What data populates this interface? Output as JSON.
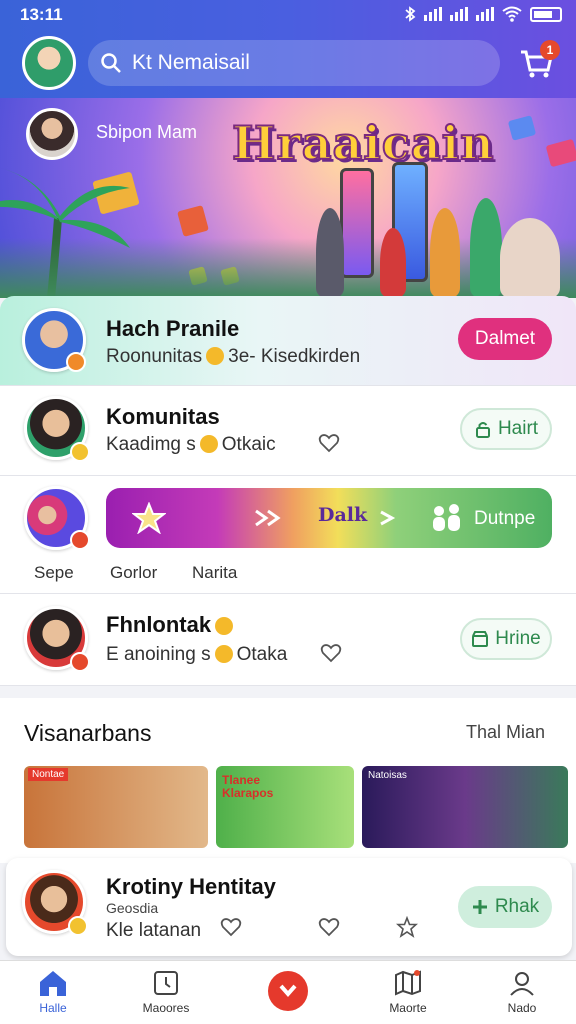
{
  "status_bar": {
    "time": "13:11"
  },
  "search": {
    "text": "Kt Nemaisail"
  },
  "cart": {
    "badge": "1"
  },
  "banner": {
    "user_name": "Sbipon Mam",
    "title": "Hraaicain"
  },
  "cards": [
    {
      "title": "Hach Pranile",
      "subtitle": "Roonunitas",
      "subtitle2": "3e- Kisedkirden",
      "button": "Dalmet"
    },
    {
      "title": "Komunitas",
      "subtitle": "Kaadimg s",
      "subtitle2": "Otkaic",
      "button": "Hairt"
    },
    {
      "title": "Fhnlontak",
      "subtitle": "E anoining s",
      "subtitle2": "Otaka",
      "button": "Hrine"
    }
  ],
  "rainbow": {
    "center_label": "Dalk",
    "right_label": "Dutnpe",
    "tabs": [
      "Sepe",
      "Gorlor",
      "Narita"
    ]
  },
  "section": {
    "title": "Visanarbans",
    "link": "Thal Mian",
    "thumbs": [
      {
        "tag": "Nontae"
      },
      {
        "tag": "Tlanee Klarapos"
      },
      {
        "tag": "Natoisas"
      }
    ]
  },
  "bottom_card": {
    "title": "Krotiny Hentitay",
    "meta": "Geosdia",
    "subtitle": "Kle latanan",
    "button": "Rhak"
  },
  "nav": {
    "items": [
      "Halle",
      "Maoores",
      "Maorte",
      "Nado"
    ]
  },
  "colors": {
    "header": "#3a63d8",
    "accent_pink": "#e0307e",
    "accent_green": "#2e8a4e",
    "accent_red": "#e5392c"
  }
}
